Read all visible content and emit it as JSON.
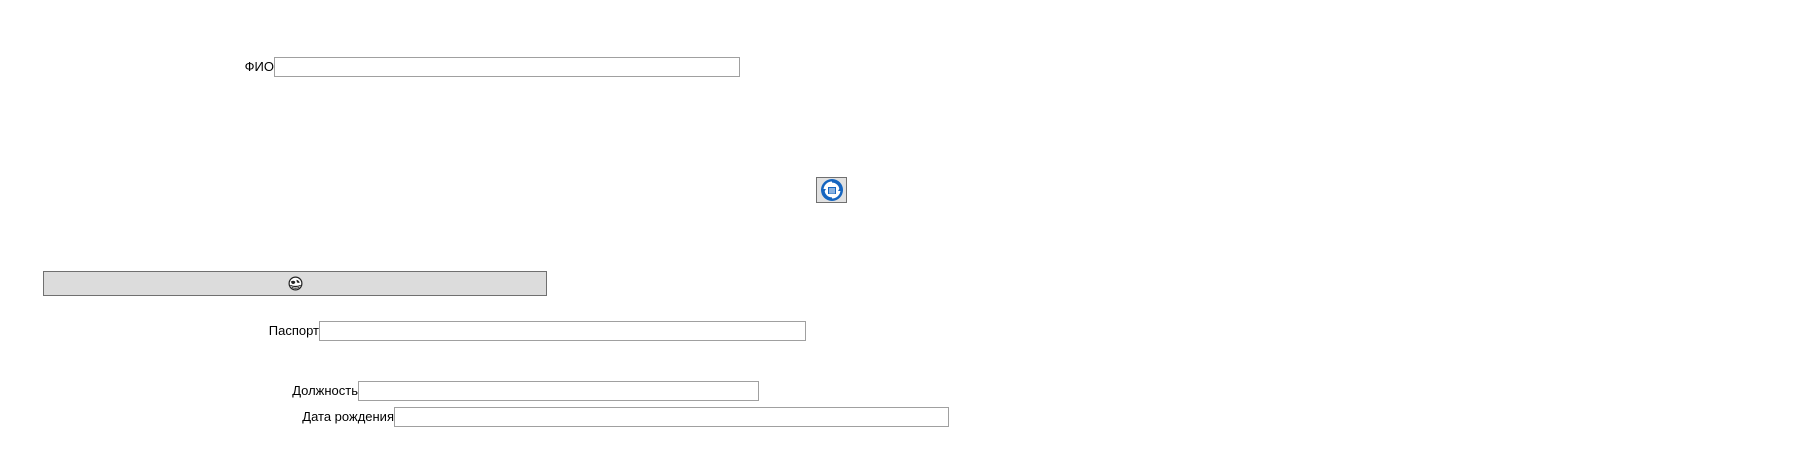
{
  "form": {
    "fio_label": "ФИО",
    "fio_value": "",
    "passport_label": "Паспорт",
    "passport_value": "",
    "position_label": "Должность",
    "position_value": "",
    "birthdate_label": "Дата рождения",
    "birthdate_value": ""
  },
  "icons": {
    "top_button_icon": "refresh-database-icon",
    "wide_button_icon": "globe-icon"
  },
  "colors": {
    "input_border": "#a0a0a0",
    "button_bg": "#e1e1e1",
    "wide_button_bg": "#dcdcdc",
    "icon_blue": "#1565c0"
  }
}
